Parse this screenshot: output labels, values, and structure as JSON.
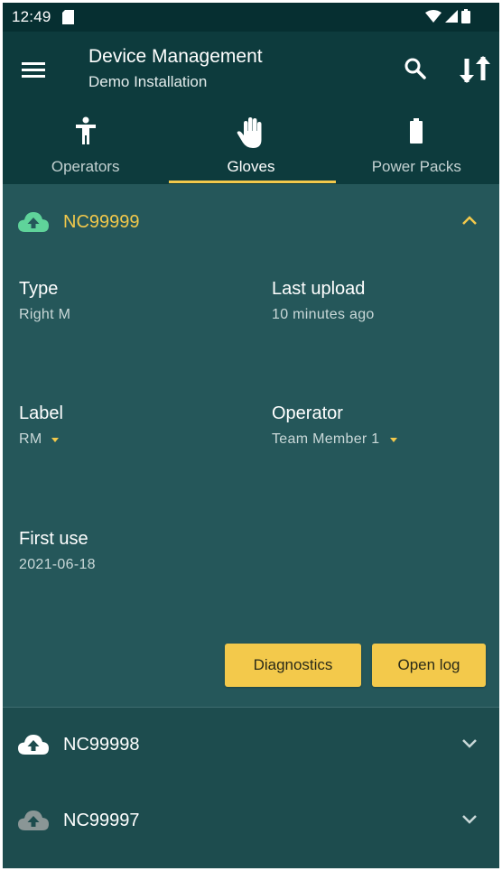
{
  "status_bar": {
    "time": "12:49"
  },
  "app_bar": {
    "title": "Device Management",
    "subtitle": "Demo Installation"
  },
  "tabs": [
    {
      "label": "Operators",
      "icon": "person-icon",
      "active": false
    },
    {
      "label": "Gloves",
      "icon": "hand-icon",
      "active": true
    },
    {
      "label": "Power Packs",
      "icon": "battery-icon",
      "active": false
    }
  ],
  "colors": {
    "accent": "#f3c94b",
    "app_bar": "#0d3b3d",
    "panel_expanded": "#25575a",
    "background": "#1d4c4e",
    "cloud_synced": "#5fd39a",
    "cloud_pending": "#ffffff",
    "cloud_offline": "#8a9696"
  },
  "devices": [
    {
      "id": "NC99999",
      "expanded": true,
      "cloud_icon": "cloud-upload-icon",
      "fields": {
        "type_label": "Type",
        "type_value": "Right M",
        "last_upload_label": "Last upload",
        "last_upload_value": "10 minutes ago",
        "label_label": "Label",
        "label_value": "RM",
        "operator_label": "Operator",
        "operator_value": "Team Member 1",
        "first_use_label": "First use",
        "first_use_value": "2021-06-18"
      },
      "buttons": {
        "diagnostics": "Diagnostics",
        "open_log": "Open log"
      }
    },
    {
      "id": "NC99998",
      "expanded": false,
      "cloud_icon": "cloud-upload-icon"
    },
    {
      "id": "NC99997",
      "expanded": false,
      "cloud_icon": "cloud-upload-icon"
    }
  ]
}
